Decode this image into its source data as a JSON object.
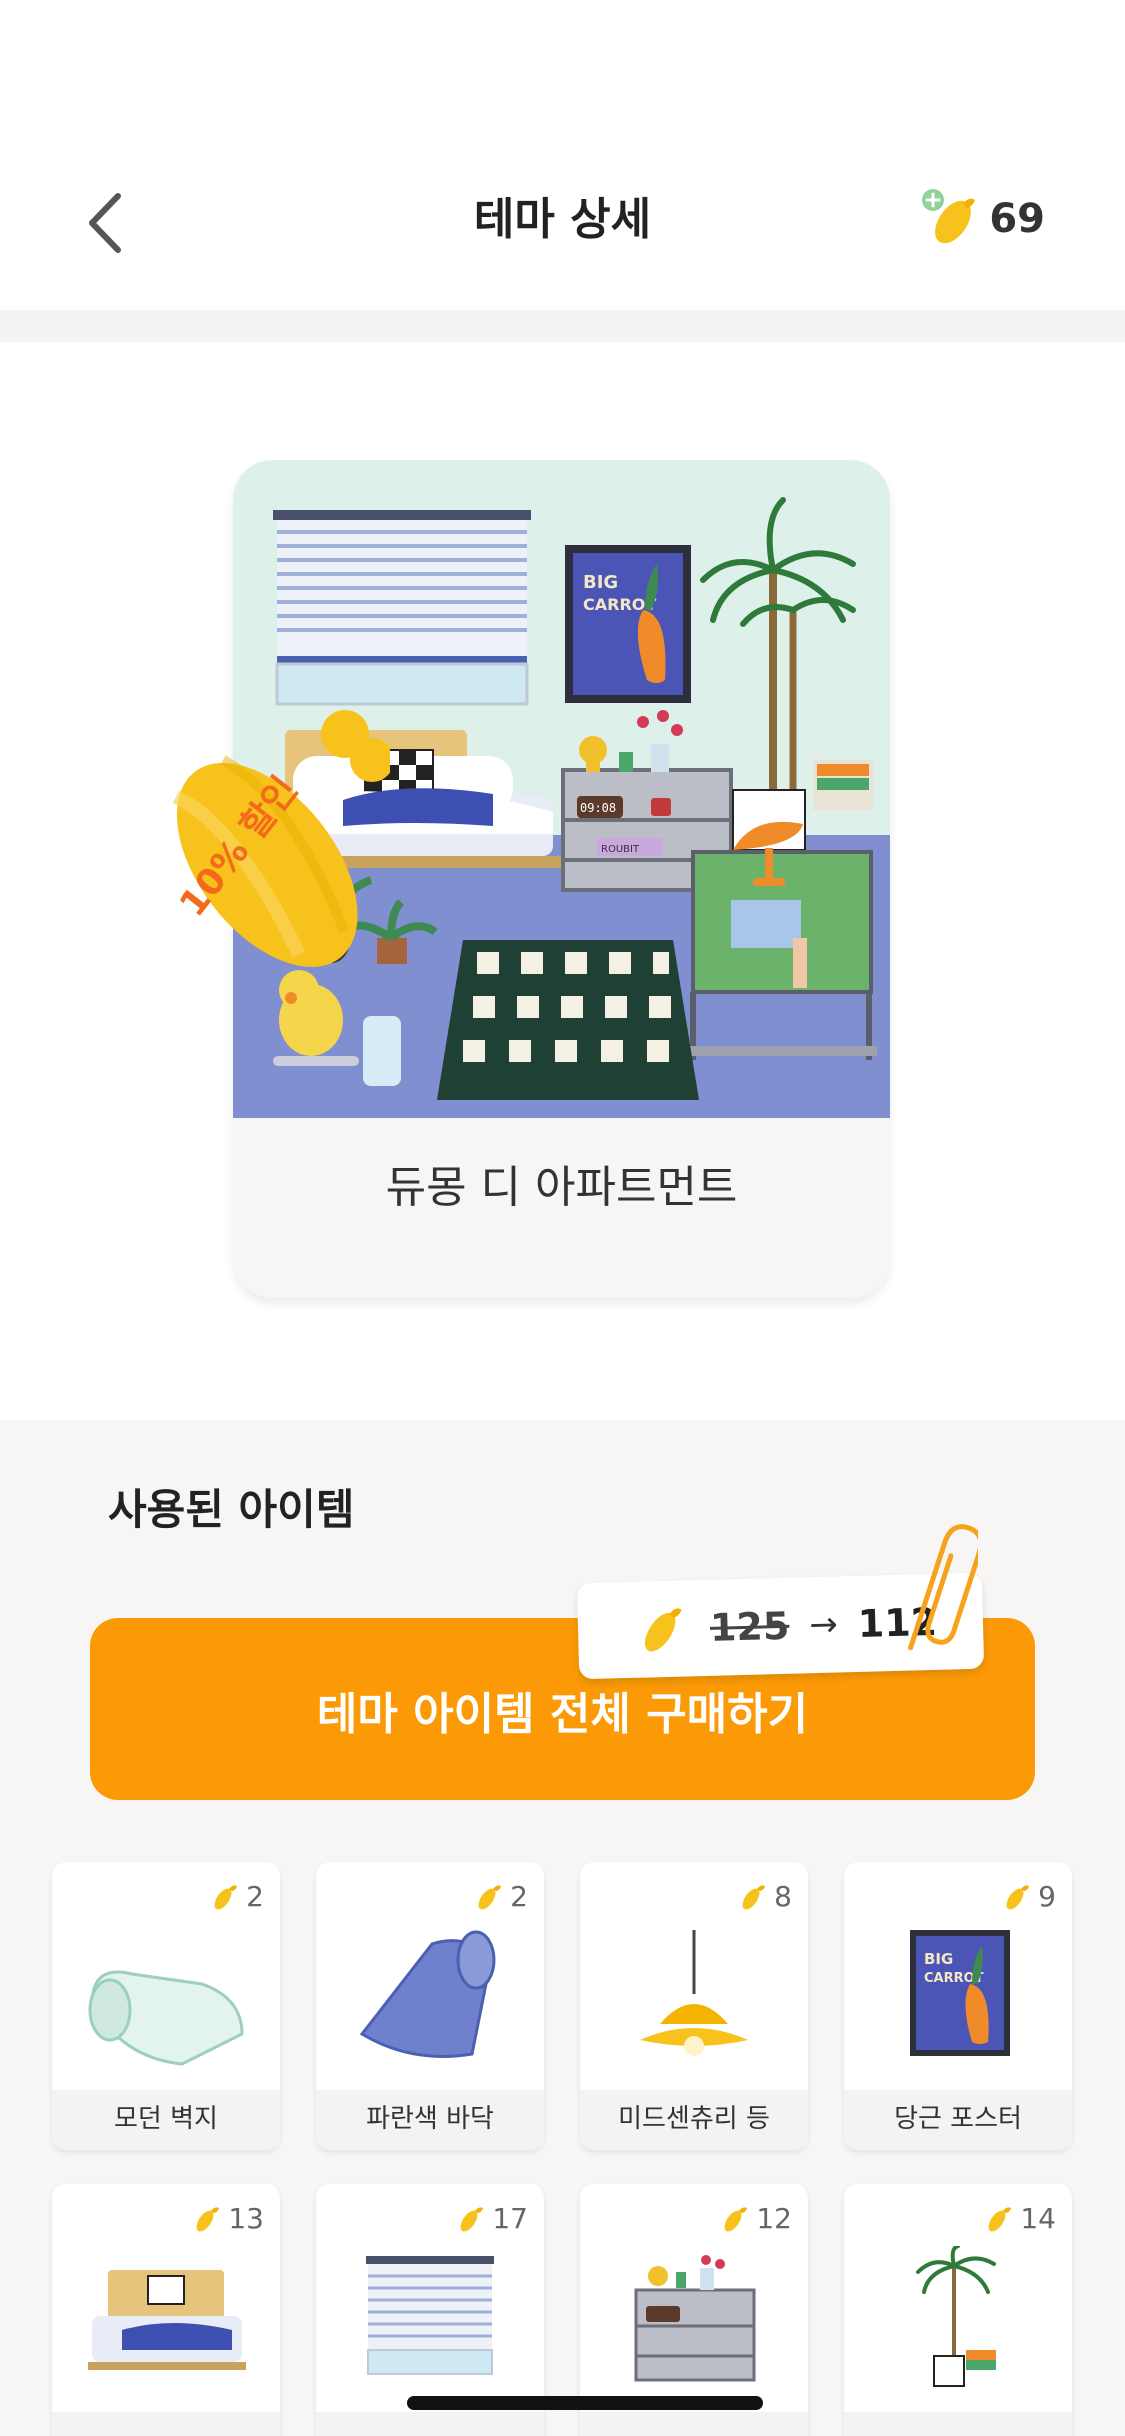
{
  "nav": {
    "title": "테마 상세",
    "carrot_count": "69"
  },
  "theme": {
    "name": "듀몽 디 아파트먼트",
    "discount_badge": "10% 할인",
    "poster_text": "BIG CARROT",
    "clock_text": "09:08",
    "book_text": "ROUBIT"
  },
  "section": {
    "title": "사용된 아이템"
  },
  "buy": {
    "label": "테마 아이템 전체 구매하기",
    "old_price": "125",
    "arrow": "→",
    "new_price": "112"
  },
  "items": [
    {
      "label": "모던 벽지",
      "price": "2",
      "icon": "wallpaper-roll-icon"
    },
    {
      "label": "파란색 바닥",
      "price": "2",
      "icon": "floor-roll-icon"
    },
    {
      "label": "미드센츄리 등",
      "price": "8",
      "icon": "pendant-lamp-icon"
    },
    {
      "label": "당근 포스터",
      "price": "9",
      "icon": "carrot-poster-icon"
    },
    {
      "label": "",
      "price": "13",
      "icon": "bed-icon"
    },
    {
      "label": "",
      "price": "17",
      "icon": "blinds-icon"
    },
    {
      "label": "",
      "price": "12",
      "icon": "shelf-icon"
    },
    {
      "label": "",
      "price": "14",
      "icon": "palm-plant-icon"
    }
  ],
  "colors": {
    "accent": "#fb9a06",
    "carrot": "#f7c21b",
    "floor": "#7f8fd0",
    "wall": "#ddf1ea"
  }
}
